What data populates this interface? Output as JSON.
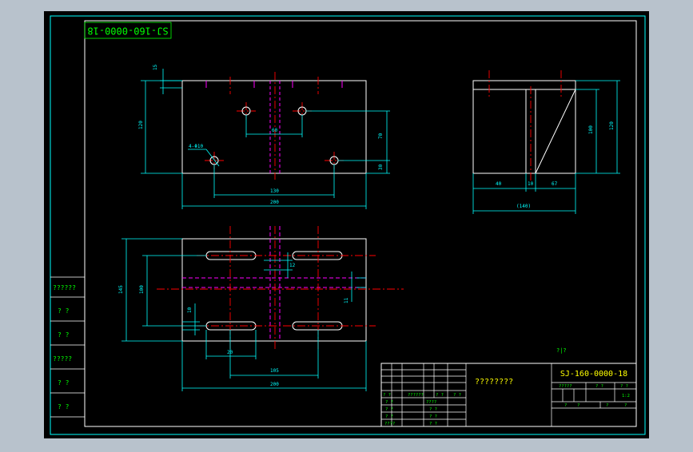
{
  "drawing": {
    "stamp_number": "SJ-160-0000-18",
    "side_labels": [
      "??????",
      "? ?",
      "? ?",
      "?????",
      "? ?",
      "? ?"
    ],
    "title_block": {
      "part_name": "????????",
      "drawing_number": "SJ-160-0000-18",
      "note_above": "?|?",
      "scale": "1:2",
      "grid_header": [
        "? ?",
        "??????",
        "? ?",
        "? ?"
      ],
      "grid_rows": [
        "? ?",
        "? ?",
        "? ?",
        "????"
      ],
      "grid_cells": [
        "????",
        "? ?",
        "? ?",
        "? ?"
      ],
      "right_top_cells": [
        "?????",
        "? ?",
        "? ?"
      ],
      "right_bottom_cells": [
        "?",
        "?",
        "?",
        "?"
      ]
    },
    "dimensions": {
      "front": {
        "top_small": "15",
        "left_height": "120",
        "center_gap": "60",
        "right_upper": "70",
        "right_lower": "30",
        "hole_span": "130",
        "total_width": "200",
        "hole_note": "4-Φ10"
      },
      "side": {
        "height_inner": "100",
        "height_outer": "120",
        "left": "40",
        "mid": "10",
        "right": "67",
        "total": "(140)"
      },
      "plan": {
        "left_outer": "145",
        "left_inner": "100",
        "left_small": "10",
        "slot_width": "12",
        "right_small": "11",
        "slot_len": "20",
        "slot_span": "105",
        "total_width": "200"
      }
    },
    "colors": {
      "background": "#000000",
      "border": "#00ffff",
      "outline": "#ffffff",
      "dimension": "#00ffff",
      "centerline": "#ff0000",
      "hidden": "#ff00ff",
      "text": "#00ff00",
      "title_text": "#ffff00"
    }
  }
}
